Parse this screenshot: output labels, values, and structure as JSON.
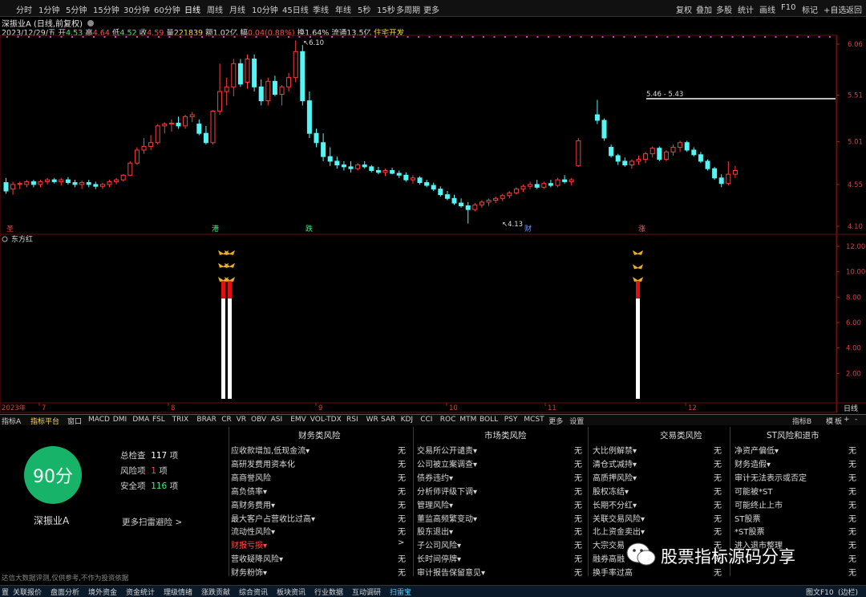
{
  "toolbar": {
    "periods": [
      "分时",
      "1分钟",
      "5分钟",
      "15分钟",
      "30分钟",
      "60分钟",
      "日线",
      "周线",
      "月线",
      "10分钟",
      "45日线",
      "季线",
      "年线",
      "5秒",
      "15秒",
      "多周期",
      "更多"
    ],
    "active_period": "日线",
    "right_buttons": [
      "复权",
      "叠加",
      "多股",
      "统计",
      "画线",
      "F10",
      "标记",
      "+自选",
      "返回"
    ]
  },
  "header": {
    "stock_title": "深振业A",
    "adjust": "(日线,前复权)",
    "date": "2023/12/29/五",
    "open_label": "开",
    "open": "4.53",
    "high_label": "高",
    "high": "4.64",
    "low_label": "低",
    "low": "4.52",
    "close_label": "收",
    "close": "4.59",
    "volume_label": "量",
    "volume": "221839",
    "amount_label": "额",
    "amount": "1.02亿",
    "change_label": "幅",
    "change": "0.04(0.88%)",
    "turnover_label": "换",
    "turnover": "1.64%",
    "float_label": "流通",
    "float_value": "13.5亿",
    "sector": "住宅开发"
  },
  "main_chart": {
    "y_ticks": [
      "6.06",
      "5.51",
      "5.01",
      "4.55",
      "4.10"
    ],
    "high_label": "6.10",
    "low_label": "4.13",
    "range_label": "5.46 - 5.43",
    "markers": [
      "港",
      "跌",
      "财",
      "涨",
      "圣"
    ],
    "up_color": "#ff3b3b",
    "down_color": "#54f5f5"
  },
  "indicator_panel": {
    "name": "东方红",
    "y_ticks": [
      "12.00",
      "10.00",
      "8.00",
      "6.00",
      "4.00",
      "2.00"
    ]
  },
  "xaxis": {
    "labels": [
      "2023年",
      "7",
      "8",
      "9",
      "10",
      "11",
      "12"
    ],
    "right_label": "日线"
  },
  "right_mini": [
    "指标B",
    "模",
    "板"
  ],
  "indicator_tabs": [
    "指标A",
    "指标平台",
    "窗口",
    "MACD",
    "DMI",
    "DMA",
    "FSL",
    "TRIX",
    "BRAR",
    "CR",
    "VR",
    "OBV",
    "ASI",
    "EMV",
    "VOL-TDX",
    "RSI",
    "WR",
    "SAR",
    "KDJ",
    "CCI",
    "ROC",
    "MTM",
    "BOLL",
    "PSY",
    "MCST",
    "更多",
    "设置"
  ],
  "scan": {
    "score": "90分",
    "total_label": "总检查",
    "total": "117",
    "total_unit": "项",
    "risk_label": "风险项",
    "risk": "1",
    "risk_unit": "项",
    "safe_label": "安全项",
    "safe": "116",
    "safe_unit": "项",
    "stock_name": "深振业A",
    "more_link": "更多扫雷避险 >",
    "disclaimer": "达信大数据评测,仅供参考,不作为投资依据"
  },
  "risk_columns": [
    {
      "title": "财务类风险",
      "items": [
        {
          "name": "应收款增加,低现金流▾",
          "value": "无"
        },
        {
          "name": "高研发费用资本化",
          "value": "无"
        },
        {
          "name": "高商誉风险",
          "value": "无"
        },
        {
          "name": "高负债率▾",
          "value": "无"
        },
        {
          "name": "高财务费用▾",
          "value": "无"
        },
        {
          "name": "最大客户占营收比过高▾",
          "value": "无"
        },
        {
          "name": "流动性风险▾",
          "value": "无"
        },
        {
          "name": "财报亏损▾",
          "value": ">",
          "highlight": true
        },
        {
          "name": "营收疑降风险▾",
          "value": "无"
        },
        {
          "name": "财务粉饰▾",
          "value": "无"
        }
      ]
    },
    {
      "title": "市场类风险",
      "items": [
        {
          "name": "交易所公开谴责▾",
          "value": "无"
        },
        {
          "name": "公司被立案调查▾",
          "value": "无"
        },
        {
          "name": "债券违约▾",
          "value": "无"
        },
        {
          "name": "分析师评级下调▾",
          "value": "无"
        },
        {
          "name": "管理风险▾",
          "value": "无"
        },
        {
          "name": "董监高频繁变动▾",
          "value": "无"
        },
        {
          "name": "股东退出▾",
          "value": "无"
        },
        {
          "name": "子公司风险▾",
          "value": "无"
        },
        {
          "name": "长时间停牌▾",
          "value": "无"
        },
        {
          "name": "审计报告保留意见▾",
          "value": "无"
        }
      ]
    },
    {
      "title": "交易类风险",
      "items": [
        {
          "name": "大比例解禁▾",
          "value": "无"
        },
        {
          "name": "清仓式减持▾",
          "value": "无"
        },
        {
          "name": "高质押风险▾",
          "value": "无"
        },
        {
          "name": "股权冻结▾",
          "value": "无"
        },
        {
          "name": "长期不分红▾",
          "value": "无"
        },
        {
          "name": "关联交易风险▾",
          "value": "无"
        },
        {
          "name": "北上资金卖出▾",
          "value": "无"
        },
        {
          "name": "大宗交易",
          "value": "无"
        },
        {
          "name": "融券高融",
          "value": "无"
        },
        {
          "name": "换手率过高",
          "value": "无"
        }
      ]
    },
    {
      "title": "ST风险和退市",
      "items": [
        {
          "name": "净资产偏低▾",
          "value": "无"
        },
        {
          "name": "财务造假▾",
          "value": "无"
        },
        {
          "name": "审计无法表示或否定",
          "value": "无"
        },
        {
          "name": "可能被*ST",
          "value": "无"
        },
        {
          "name": "可能终止上市",
          "value": "无"
        },
        {
          "name": "ST股票",
          "value": "无"
        },
        {
          "name": "*ST股票",
          "value": "无"
        },
        {
          "name": "进入退市整理",
          "value": "无"
        },
        {
          "name": "",
          "value": "无"
        },
        {
          "name": "",
          "value": "无"
        }
      ]
    }
  ],
  "watermark": "股票指标源码分享",
  "statusbar": [
    "置",
    "关联报价",
    "盘面分析",
    "境外资金",
    "资金统计",
    "理级情绪",
    "涨跌贡献",
    "综合资讯",
    "板块资讯",
    "行业数据",
    "互动调研",
    "扫雷宝"
  ],
  "statusbar_right": [
    "图文F10",
    "(边栏)"
  ]
}
